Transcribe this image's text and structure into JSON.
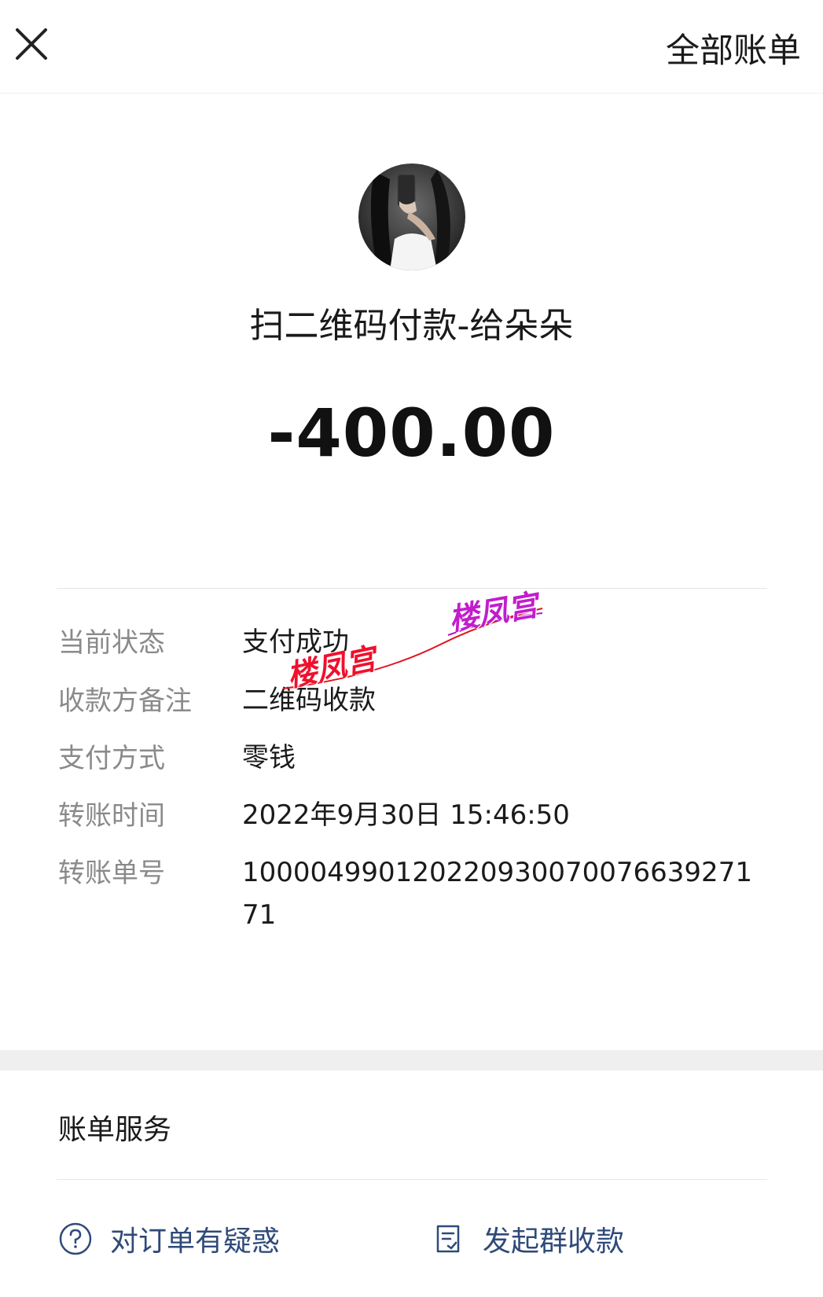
{
  "header": {
    "close_icon": "close-icon",
    "all_bills_label": "全部账单"
  },
  "payee": {
    "title": "扫二维码付款-给朵朵"
  },
  "amount": "-400.00",
  "details": [
    {
      "label": "当前状态",
      "value": "支付成功"
    },
    {
      "label": "收款方备注",
      "value": "二维码收款"
    },
    {
      "label": "支付方式",
      "value": "零钱"
    },
    {
      "label": "转账时间",
      "value": "2022年9月30日 15:46:50"
    },
    {
      "label": "转账单号",
      "value": "100004990120220930070076639271 71"
    }
  ],
  "watermarks": [
    "楼凤宫",
    "楼凤宫"
  ],
  "services": {
    "title": "账单服务",
    "items": [
      {
        "label": "对订单有疑惑",
        "icon": "question-circle-icon"
      },
      {
        "label": "发起群收款",
        "icon": "document-icon"
      }
    ]
  },
  "colors": {
    "service_text": "#2f4a7a",
    "label_gray": "#8a8a8a",
    "watermark_red": "#f0102c",
    "watermark_purple": "#c21ccc"
  }
}
